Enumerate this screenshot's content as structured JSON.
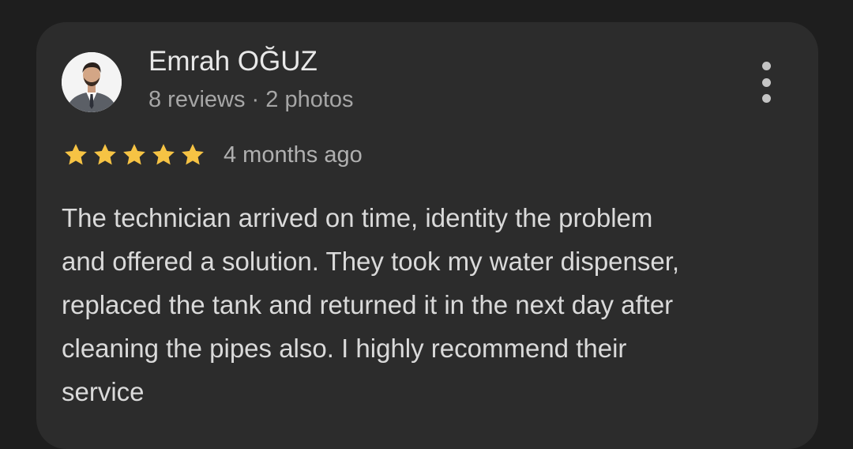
{
  "reviewer": {
    "name": "Emrah OĞUZ",
    "meta": "8 reviews · 2 photos",
    "avatar_icon": "user-portrait-icon"
  },
  "menu": {
    "icon": "more-vert-icon"
  },
  "rating": {
    "stars": 5,
    "max_stars": 5,
    "star_color": "#f6c344",
    "time_ago": "4 months ago"
  },
  "review": {
    "lines": [
      "The technician arrived on time, identity the problem",
      "and offered a solution. They took my water dispenser,",
      "replaced the tank and returned it in the next day after",
      "cleaning the pipes also. I highly recommend their",
      "service"
    ]
  },
  "colors": {
    "page_background": "#1e1e1e",
    "card_background": "#2c2c2c",
    "primary_text": "#e8e8e8",
    "secondary_text": "#a6a6a6"
  }
}
